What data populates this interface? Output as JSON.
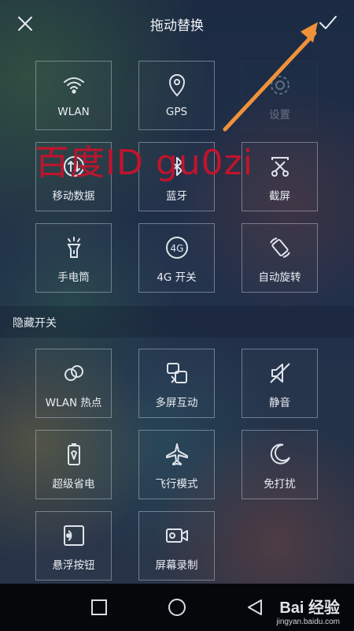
{
  "header": {
    "title": "拖动替换"
  },
  "active_tiles": [
    {
      "label": "WLAN",
      "icon": "wifi-icon"
    },
    {
      "label": "GPS",
      "icon": "location-pin-icon"
    },
    {
      "label": "设置",
      "icon": "gear-icon"
    },
    {
      "label": "移动数据",
      "icon": "mobile-data-icon"
    },
    {
      "label": "蓝牙",
      "icon": "bluetooth-icon"
    },
    {
      "label": "截屏",
      "icon": "screenshot-scissors-icon"
    },
    {
      "label": "手电筒",
      "icon": "flashlight-icon"
    },
    {
      "label": "4G 开关",
      "icon": "4g-icon"
    },
    {
      "label": "自动旋转",
      "icon": "auto-rotate-icon"
    }
  ],
  "section": {
    "label": "隐藏开关"
  },
  "hidden_tiles": [
    {
      "label": "WLAN 热点",
      "icon": "hotspot-link-icon"
    },
    {
      "label": "多屏互动",
      "icon": "multi-screen-icon"
    },
    {
      "label": "静音",
      "icon": "mute-icon"
    },
    {
      "label": "超级省电",
      "icon": "battery-saver-icon"
    },
    {
      "label": "飞行模式",
      "icon": "airplane-icon"
    },
    {
      "label": "免打扰",
      "icon": "moon-icon"
    },
    {
      "label": "悬浮按钮",
      "icon": "floating-button-icon"
    },
    {
      "label": "屏幕录制",
      "icon": "screen-record-icon"
    }
  ],
  "watermark": {
    "text": "百度ID gu0zi"
  },
  "brand": {
    "name": "Bai 经验",
    "site": "jingyan.baidu.com"
  },
  "colors": {
    "accent_arrow": "#f0923a",
    "watermark": "#c0142d"
  }
}
